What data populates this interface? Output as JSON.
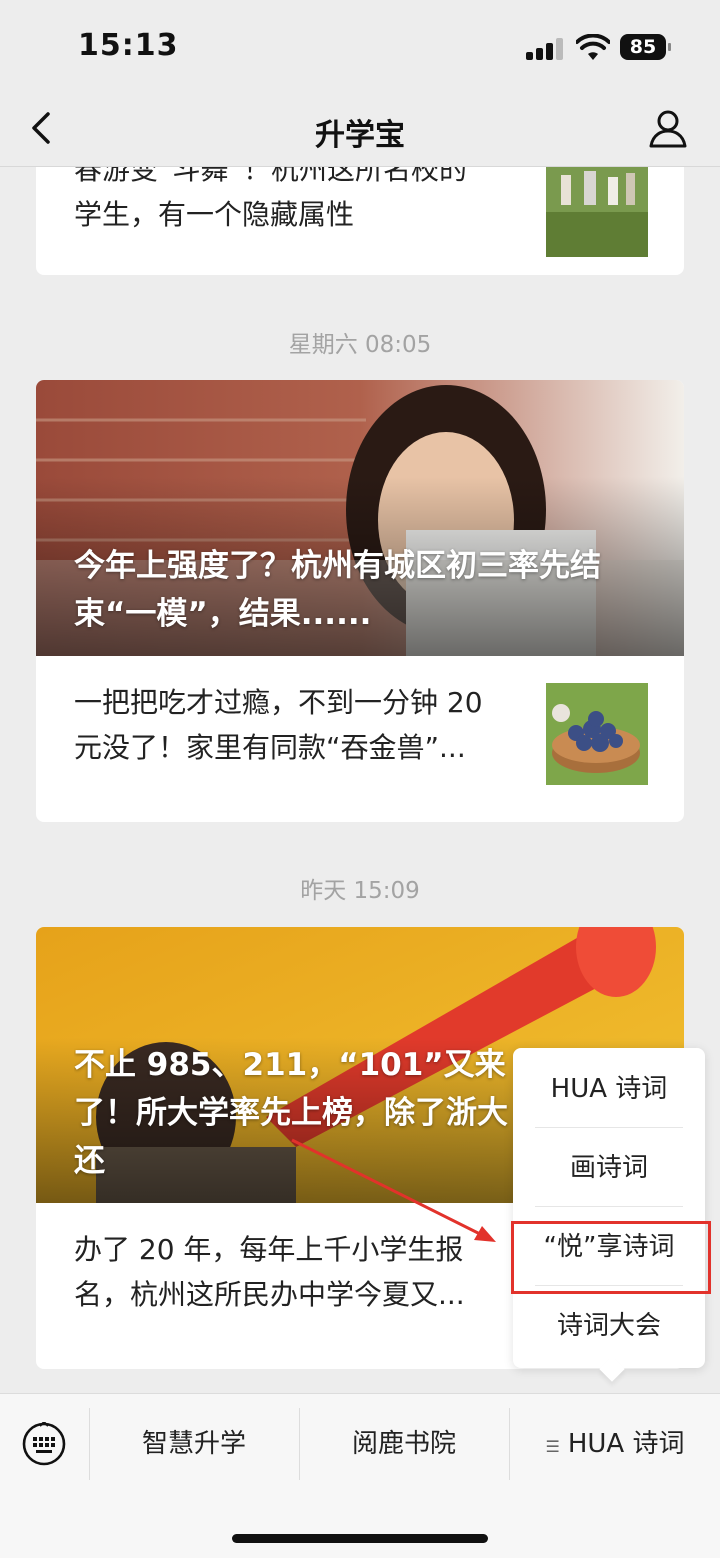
{
  "status_bar": {
    "time": "15:13",
    "battery": "85"
  },
  "nav": {
    "title": "升学宝"
  },
  "feed": {
    "top_partial": {
      "title_cut": "春游变“斗舞”！杭州这所名校的",
      "title_line2": "学生，有一个隐藏属性"
    },
    "groups": [
      {
        "timestamp": "星期六 08:05",
        "hero_title": "今年上强度了？杭州有城区初三率先结束“一模”，结果......",
        "item_title": "一把把吃才过瘾，不到一分钟 20 元没了！家里有同款“吞金兽”..."
      },
      {
        "timestamp": "昨天 15:09",
        "hero_title": "不止 985、211，“101”又来了！所大学率先上榜，除了浙大还",
        "item_title": "办了 20 年，每年上千小学生报名，杭州这所民办中学今夏又..."
      }
    ]
  },
  "bottom_menu": {
    "items": [
      "智慧升学",
      "阅鹿书院",
      "HUA 诗词"
    ]
  },
  "popup_menu": {
    "items": [
      "HUA 诗词",
      "画诗词",
      "“悦”享诗词",
      "诗词大会"
    ],
    "highlighted_index": 2,
    "highlight_color": "#e2322b"
  }
}
